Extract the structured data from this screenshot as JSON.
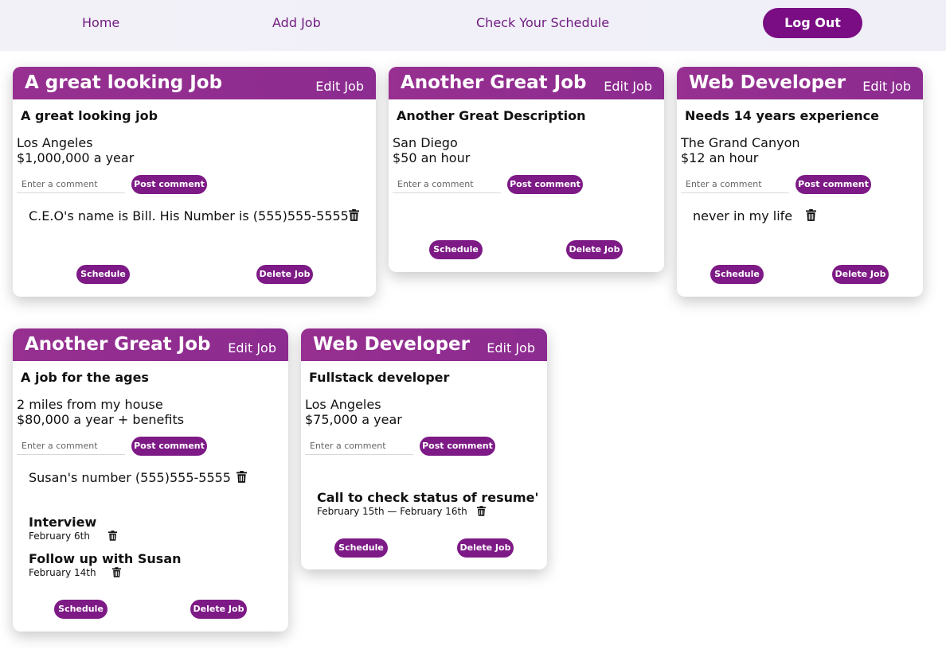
{
  "nav": {
    "home": "Home",
    "add_job": "Add Job",
    "schedule": "Check Your Schedule",
    "logout": "Log Out"
  },
  "labels": {
    "edit": "Edit Job",
    "comment_placeholder": "Enter a comment",
    "post": "Post comment",
    "schedule": "Schedule",
    "delete": "Delete Job"
  },
  "cards": [
    {
      "title": "A great looking Job",
      "description": "A great looking job",
      "location": "Los Angeles",
      "pay": "$1,000,000 a year",
      "comment": "C.E.O's name is Bill. His Number is (555)555-5555"
    },
    {
      "title": "Another Great Job",
      "description": "Another Great Description",
      "location": "San Diego",
      "pay": "$50 an hour"
    },
    {
      "title": "Web Developer",
      "description": "Needs 14 years experience",
      "location": "The Grand Canyon",
      "pay": "$12 an hour",
      "comment": "never in my life"
    },
    {
      "title": "Another Great Job",
      "description": "A job for the ages",
      "location": "2 miles from my house",
      "pay": "$80,000 a year + benefits",
      "comment": "Susan's number (555)555-5555",
      "events": [
        {
          "title": "Interview",
          "date": "February 6th"
        },
        {
          "title": "Follow up with Susan",
          "date": "February 14th"
        }
      ]
    },
    {
      "title": "Web Developer",
      "description": "Fullstack developer",
      "location": "Los Angeles",
      "pay": "$75,000 a year",
      "events": [
        {
          "title": "Call to check status of resume'",
          "date": "February 15th — February 16th"
        }
      ]
    }
  ]
}
